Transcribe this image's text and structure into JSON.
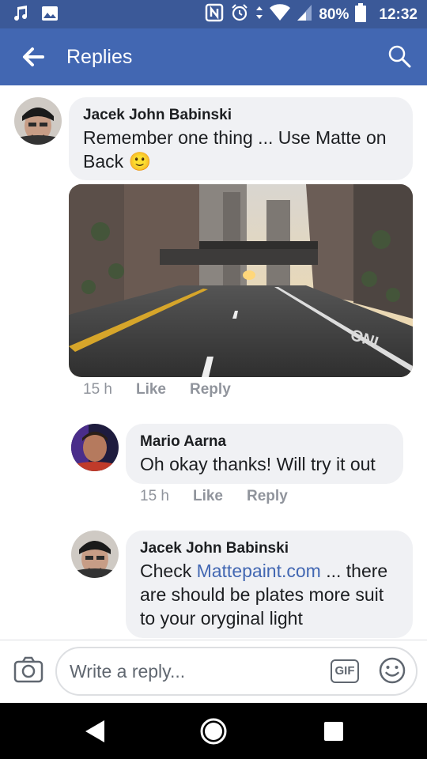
{
  "status": {
    "battery": "80%",
    "time": "12:32"
  },
  "header": {
    "title": "Replies"
  },
  "comments": [
    {
      "author": "Jacek John Babinski",
      "text": "Remember one thing ... Use Matte on",
      "text2": "Back 🙂",
      "time": "15 h",
      "like": "Like",
      "reply": "Reply"
    },
    {
      "author": "Mario Aarna",
      "text": "Oh okay thanks! Will try it out",
      "time": "15 h",
      "like": "Like",
      "reply": "Reply"
    },
    {
      "author": "Jacek John Babinski",
      "text_before": "Check ",
      "link": "Mattepaint.com",
      "text_after": " ... there",
      "text2": "are should be plates more suit",
      "text3": "to your oryginal light"
    }
  ],
  "composer": {
    "placeholder": "Write a reply...",
    "gif": "GIF"
  },
  "photo": {
    "street_marking": "ONL"
  }
}
